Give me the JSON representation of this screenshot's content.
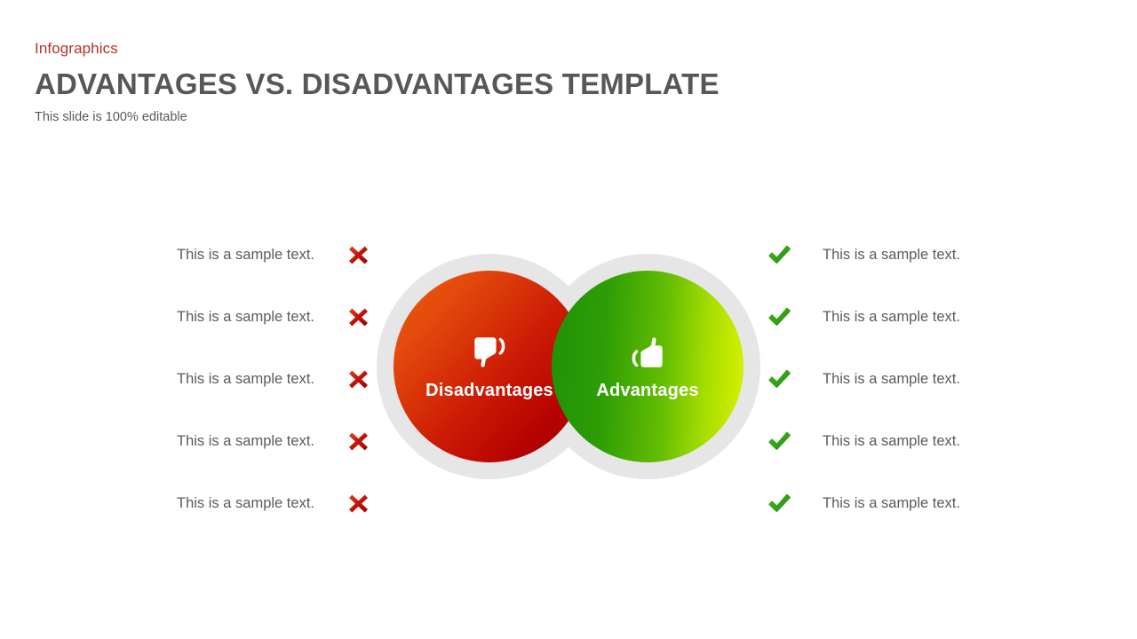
{
  "header": {
    "eyebrow": "Infographics",
    "title": "ADVANTAGES VS. DISADVANTAGES TEMPLATE",
    "subtitle": "This slide is 100% editable"
  },
  "colors": {
    "eyebrow": "#b13524",
    "title": "#575757",
    "body_text": "#5b5b5b",
    "halo": "#e6e6e6",
    "cross_icon": "#c0150a",
    "check_icon": "#35a01a",
    "red_bubble_start": "#ee5b10",
    "red_bubble_end": "#aa0000",
    "green_bubble_start": "#1f9306",
    "green_bubble_end": "#d9f200",
    "background": "#ffffff"
  },
  "center": {
    "left_bubble": {
      "label": "Disadvantages",
      "icon": "thumbs-down-icon"
    },
    "right_bubble": {
      "label": "Advantages",
      "icon": "thumbs-up-icon"
    }
  },
  "disadvantages": {
    "icon": "cross-icon",
    "items": [
      {
        "text": "This is a sample text."
      },
      {
        "text": "This is a sample text."
      },
      {
        "text": "This is a sample text."
      },
      {
        "text": "This is a sample text."
      },
      {
        "text": "This is a sample text."
      }
    ]
  },
  "advantages": {
    "icon": "check-icon",
    "items": [
      {
        "text": "This is a sample text."
      },
      {
        "text": "This is a sample text."
      },
      {
        "text": "This is a sample text."
      },
      {
        "text": "This is a sample text."
      },
      {
        "text": "This is a sample text."
      }
    ]
  }
}
